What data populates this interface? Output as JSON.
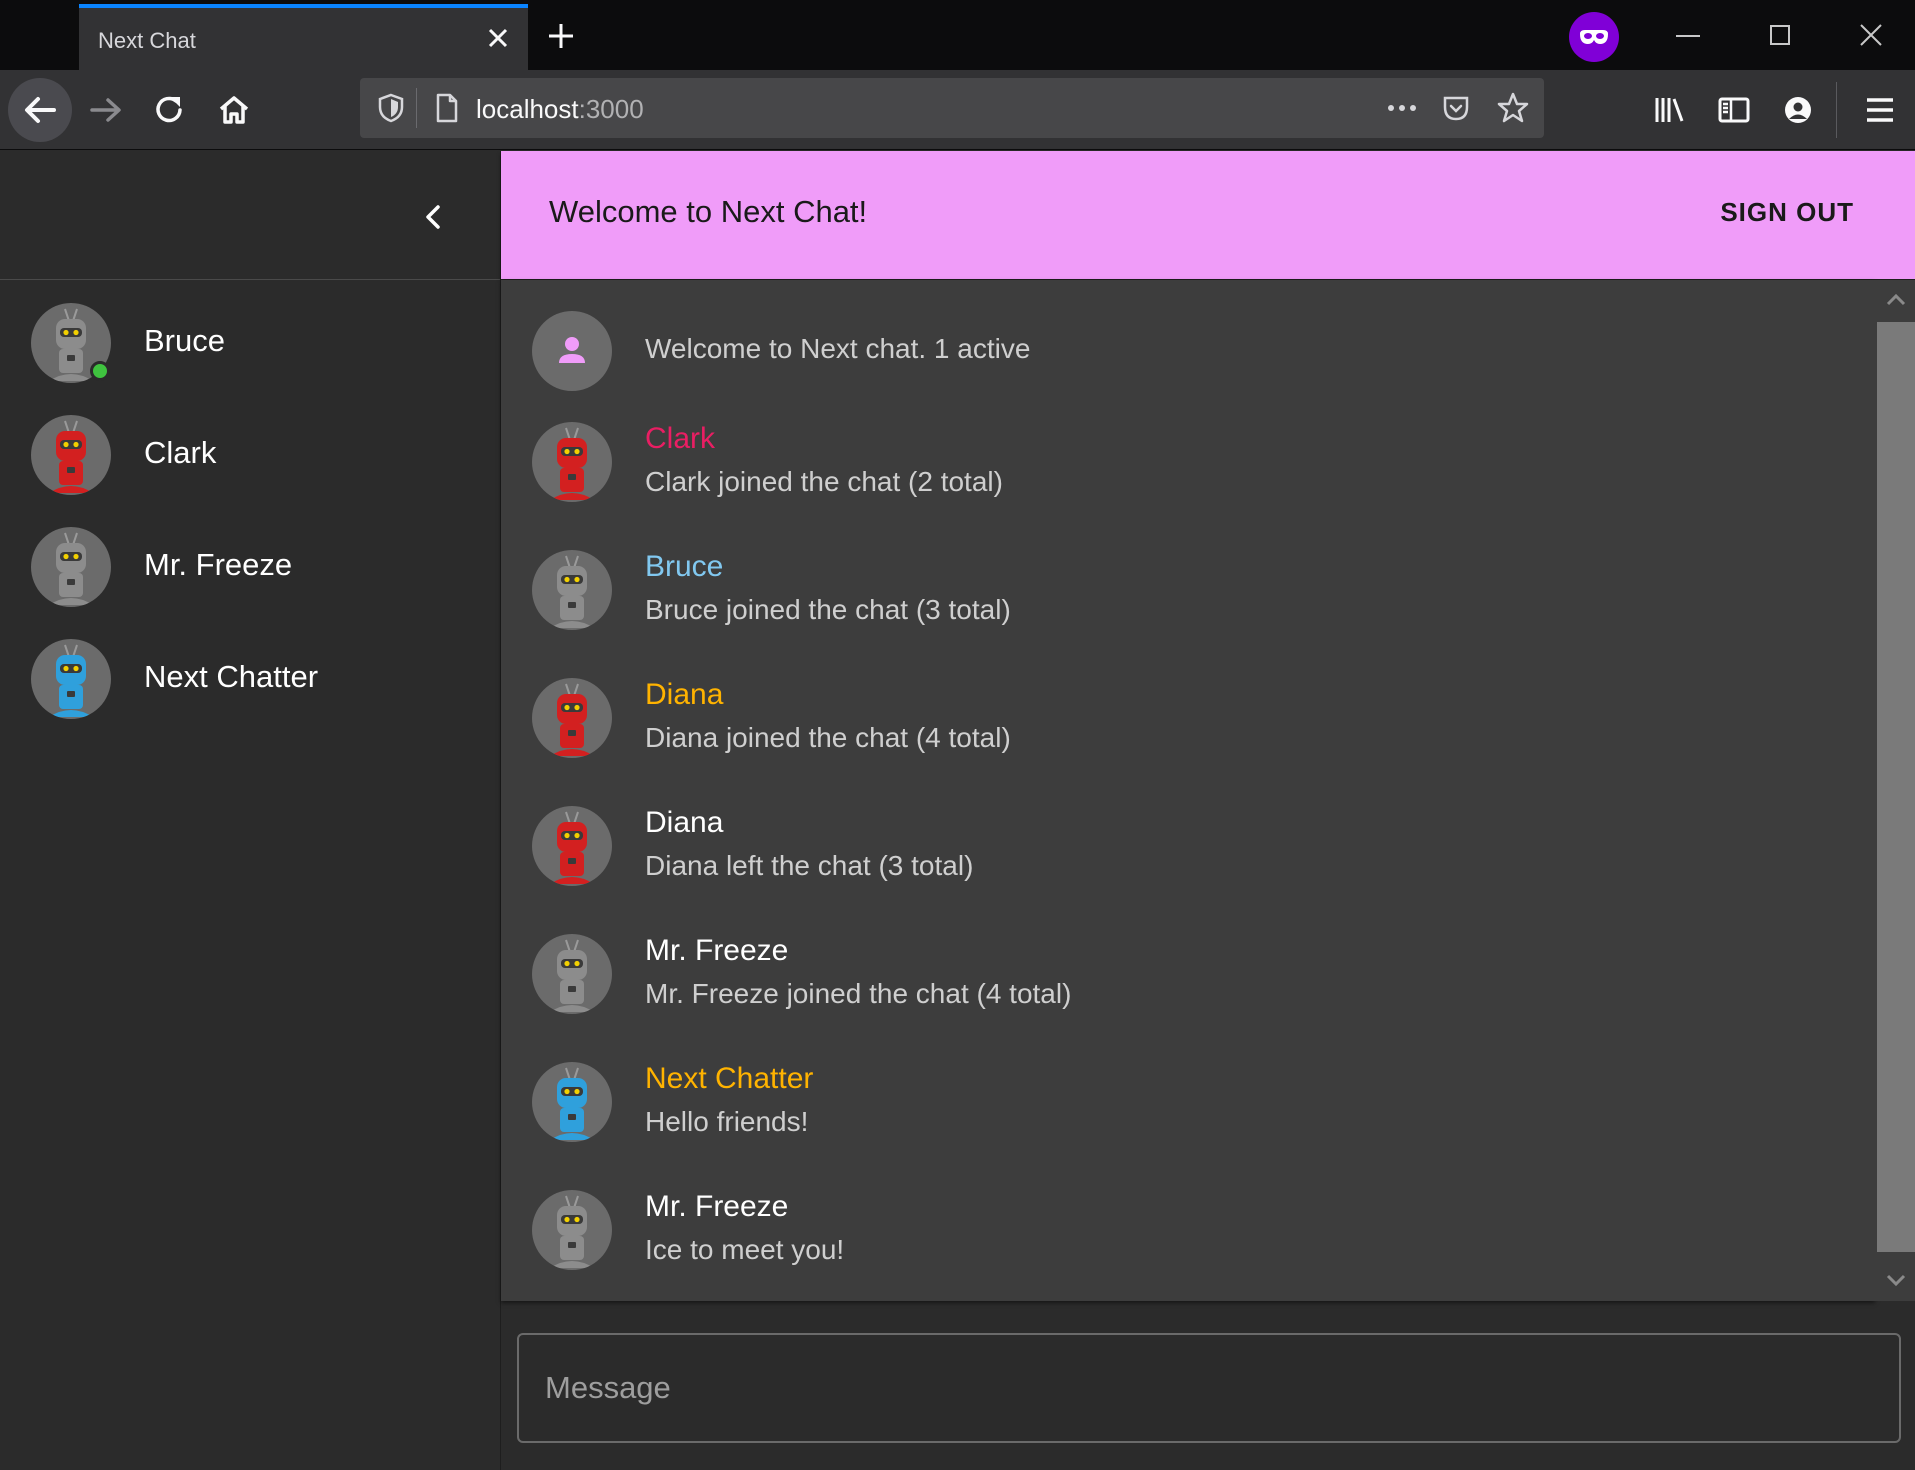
{
  "browser": {
    "tab_title": "Next Chat",
    "url_host": "localhost",
    "url_port": ":3000"
  },
  "sidebar": {
    "users": [
      {
        "name": "Bruce",
        "online": true,
        "robot_color": "#8c8c8c"
      },
      {
        "name": "Clark",
        "online": false,
        "robot_color": "#d32020"
      },
      {
        "name": "Mr. Freeze",
        "online": false,
        "robot_color": "#8c8c8c"
      },
      {
        "name": "Next Chatter",
        "online": false,
        "robot_color": "#2fa0dc"
      }
    ]
  },
  "appbar": {
    "title": "Welcome to Next Chat!",
    "signout_label": "SIGN OUT"
  },
  "messages": {
    "system": "Welcome to Next chat. 1 active",
    "items": [
      {
        "name": "Clark",
        "text": "Clark joined the chat (2 total)",
        "name_color": "#e91e63",
        "robot_color": "#d32020"
      },
      {
        "name": "Bruce",
        "text": "Bruce joined the chat (3 total)",
        "name_color": "#81c8f0",
        "robot_color": "#8c8c8c"
      },
      {
        "name": "Diana",
        "text": "Diana joined the chat (4 total)",
        "name_color": "#ffb300",
        "robot_color": "#d32020"
      },
      {
        "name": "Diana",
        "text": "Diana left the chat (3 total)",
        "name_color": "#ffffff",
        "robot_color": "#d32020"
      },
      {
        "name": "Mr. Freeze",
        "text": "Mr. Freeze joined the chat (4 total)",
        "name_color": "#ffffff",
        "robot_color": "#8c8c8c"
      },
      {
        "name": "Next Chatter",
        "text": "Hello friends!",
        "name_color": "#ffb300",
        "robot_color": "#2fa0dc"
      },
      {
        "name": "Mr. Freeze",
        "text": "Ice to meet you!",
        "name_color": "#ffffff",
        "robot_color": "#8c8c8c"
      }
    ]
  },
  "composer": {
    "placeholder": "Message",
    "value": ""
  },
  "colors": {
    "appbar": "#f09cf9",
    "online": "#3fc33f",
    "browser_accent": "#0a84ff"
  }
}
